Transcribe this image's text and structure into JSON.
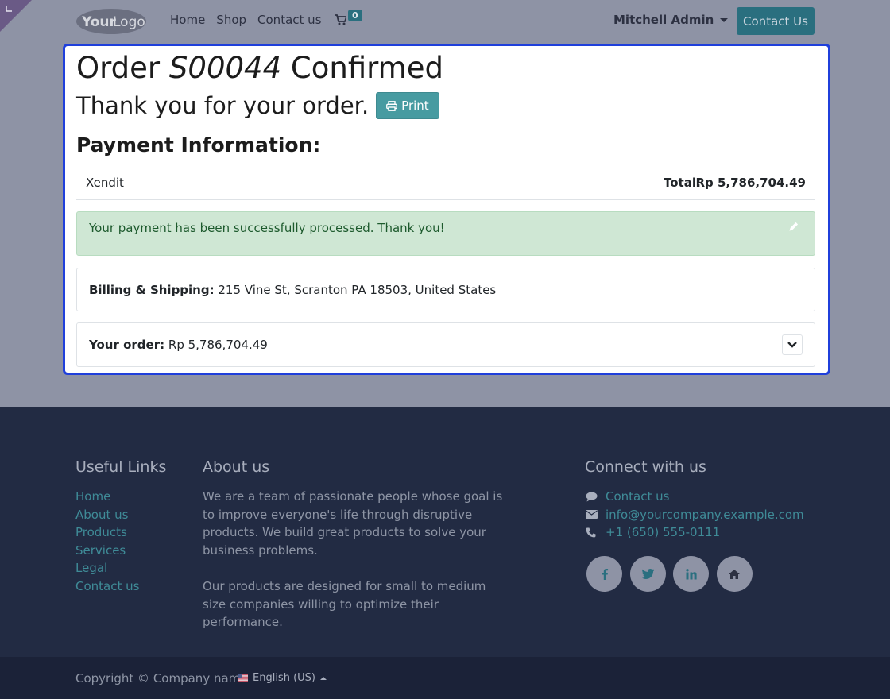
{
  "header": {
    "logo_text": "YourLogo",
    "nav": [
      "Home",
      "Shop",
      "Contact us"
    ],
    "cart_count": "0",
    "user_name": "Mitchell Admin",
    "contact_button": "Contact Us"
  },
  "order": {
    "title_prefix": "Order",
    "order_number": "S00044",
    "title_suffix": "Confirmed",
    "thank_you": "Thank you for your order.",
    "print_label": "Print",
    "payment_heading": "Payment Information:",
    "provider": "Xendit",
    "total_label": "Total:",
    "total_value": "Rp 5,786,704.49",
    "alert_message": "Your payment has been successfully processed. Thank you!",
    "billing_label": "Billing & Shipping:",
    "billing_address": "215 Vine St, Scranton PA 18503, United States",
    "your_order_label": "Your order:",
    "your_order_value": "Rp 5,786,704.49"
  },
  "footer": {
    "useful_links_heading": "Useful Links",
    "useful_links": [
      "Home",
      "About us",
      "Products",
      "Services",
      "Legal",
      "Contact us"
    ],
    "about_heading": "About us",
    "about_p1": "We are a team of passionate people whose goal is to improve everyone's life through disruptive products. We build great products to solve your business problems.",
    "about_p2": "Our products are designed for small to medium size companies willing to optimize their performance.",
    "connect_heading": "Connect with us",
    "connect": {
      "contact": "Contact us",
      "email": "info@yourcompany.example.com",
      "phone": "+1 (650) 555-0111"
    },
    "socials": [
      "facebook-icon",
      "twitter-icon",
      "linkedin-icon",
      "home-icon"
    ],
    "copyright": "Copyright © Company name",
    "language": "English (US)"
  },
  "colors": {
    "accent": "#2a6f7f",
    "focus_border": "#1f3fdb",
    "success_bg": "#cfe7d4",
    "footer_bg": "#222b43"
  }
}
